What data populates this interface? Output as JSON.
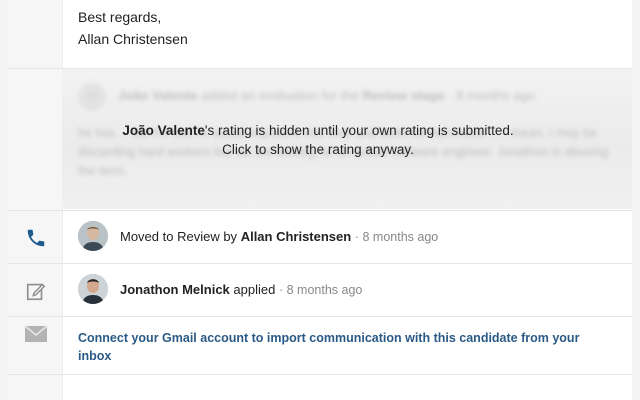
{
  "letter": {
    "closing": "Best regards,",
    "signature": "Allan Christensen"
  },
  "evaluation": {
    "avatar_initials": "JV",
    "author": "João Valente",
    "action": "added an evaluation for the",
    "stage": "Review stage",
    "time": "8 months ago",
    "body": "he has ... but he had no actual exposure into tech and lacks fundamentals ... I mean, I may be discarding hard workers but we are looking for an actual software engineer. Jonathon is abusing the term.",
    "notice_name": "João Valente",
    "notice_rest": "'s rating is hidden until your own rating is submitted.",
    "notice_action": "Click to show the rating anyway."
  },
  "timeline": [
    {
      "icon": "phone-icon",
      "prefix": "Moved to Review by",
      "actor": "Allan Christensen",
      "time": "8 months ago"
    },
    {
      "icon": "edit-icon",
      "actor": "Jonathon Melnick",
      "suffix": "applied",
      "time": "8 months ago"
    }
  ],
  "gmail": {
    "icon": "envelope-icon",
    "link_text": "Connect your Gmail account to import communication with this candidate from your inbox"
  },
  "colors": {
    "link": "#2a5a86",
    "phone_icon": "#1f5c8e",
    "muted_icon": "#9a9a9a"
  }
}
